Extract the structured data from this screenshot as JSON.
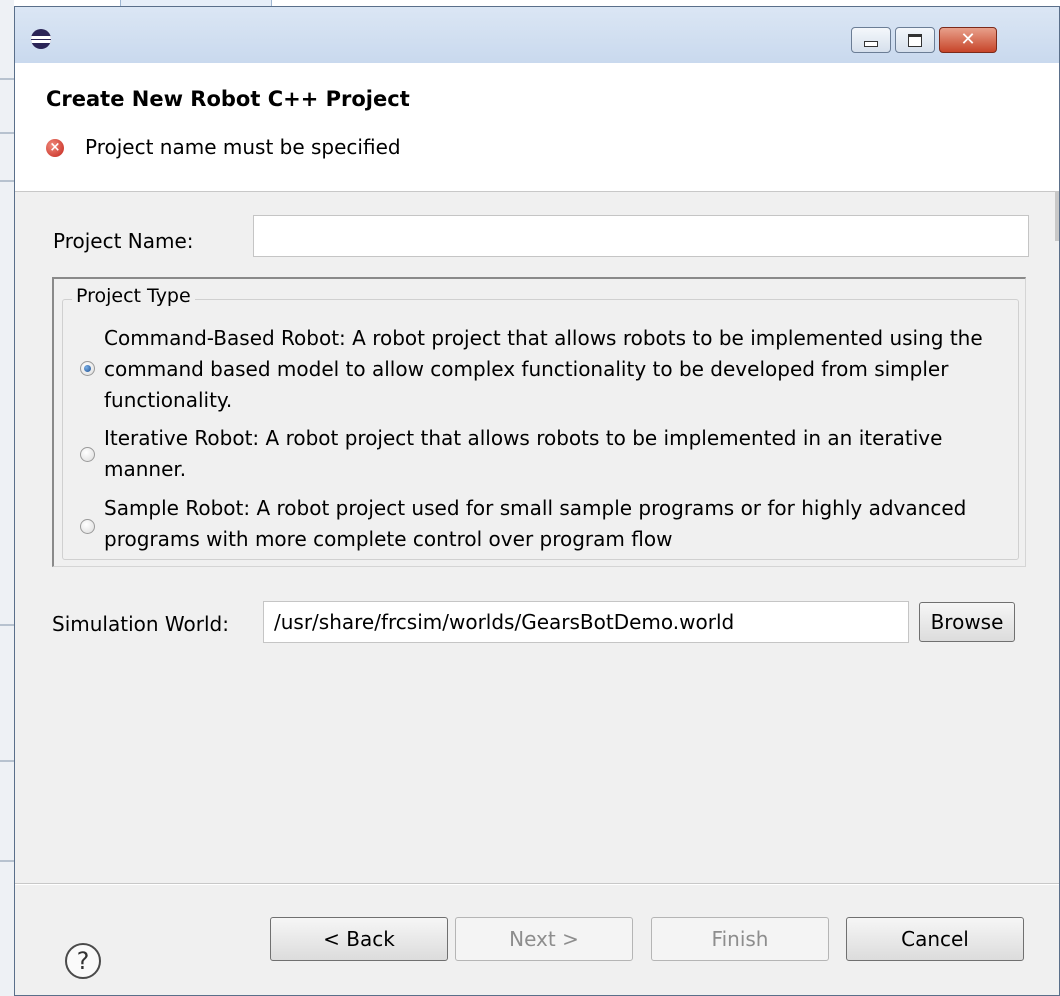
{
  "dialog": {
    "header_title": "Create New Robot C++ Project",
    "error_message": "Project name must be specified"
  },
  "window_controls": {
    "minimize": "minimize-icon",
    "maximize": "maximize-icon",
    "close": "close-icon"
  },
  "project_name": {
    "label": "Project Name:",
    "value": ""
  },
  "project_type": {
    "legend": "Project Type",
    "options": [
      {
        "label": "Command-Based Robot: A robot project that allows robots to be implemented using the command based model to allow complex functionality to be developed from simpler functionality.",
        "selected": true
      },
      {
        "label": "Iterative Robot: A robot project that allows robots to be implemented in an iterative manner.",
        "selected": false
      },
      {
        "label": "Sample Robot: A robot project used for small sample programs or for highly advanced programs with more complete control over program flow",
        "selected": false
      }
    ]
  },
  "simulation_world": {
    "label": "Simulation World:",
    "value": "/usr/share/frcsim/worlds/GearsBotDemo.world",
    "browse_label": "Browse"
  },
  "footer": {
    "help_icon": "help-icon",
    "back_label": "< Back",
    "next_label": "Next >",
    "finish_label": "Finish",
    "cancel_label": "Cancel"
  },
  "colors": {
    "error": "#c4251b",
    "radio_selected": "#1d4e8f",
    "titlebar": "#c9d9ee"
  }
}
